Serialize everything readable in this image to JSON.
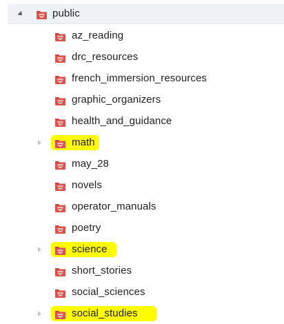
{
  "tree": {
    "root": {
      "label": "public",
      "icon": "folder-icon",
      "expanded": true
    },
    "children": [
      {
        "label": "az_reading",
        "icon": "folder-icon",
        "has_children": false,
        "highlighted": false
      },
      {
        "label": "drc_resources",
        "icon": "folder-icon",
        "has_children": false,
        "highlighted": false
      },
      {
        "label": "french_immersion_resources",
        "icon": "folder-icon",
        "has_children": false,
        "highlighted": false
      },
      {
        "label": "graphic_organizers",
        "icon": "folder-icon",
        "has_children": false,
        "highlighted": false
      },
      {
        "label": "health_and_guidance",
        "icon": "folder-icon",
        "has_children": false,
        "highlighted": false
      },
      {
        "label": "math",
        "icon": "folder-icon",
        "has_children": true,
        "highlighted": true
      },
      {
        "label": "may_28",
        "icon": "folder-icon",
        "has_children": false,
        "highlighted": false
      },
      {
        "label": "novels",
        "icon": "folder-icon",
        "has_children": false,
        "highlighted": false
      },
      {
        "label": "operator_manuals",
        "icon": "folder-icon",
        "has_children": false,
        "highlighted": false
      },
      {
        "label": "poetry",
        "icon": "folder-icon",
        "has_children": false,
        "highlighted": false
      },
      {
        "label": "science",
        "icon": "folder-icon",
        "has_children": true,
        "highlighted": true
      },
      {
        "label": "short_stories",
        "icon": "folder-icon",
        "has_children": false,
        "highlighted": false
      },
      {
        "label": "social_sciences",
        "icon": "folder-icon",
        "has_children": false,
        "highlighted": false
      },
      {
        "label": "social_studies",
        "icon": "folder-icon",
        "has_children": true,
        "highlighted": true
      }
    ]
  },
  "colors": {
    "folder_body": "#d9534f",
    "folder_tab": "#c9433f",
    "folder_mark": "#ffffff",
    "highlight": "#fffc00",
    "root_row_bg": "#eef2f7"
  }
}
